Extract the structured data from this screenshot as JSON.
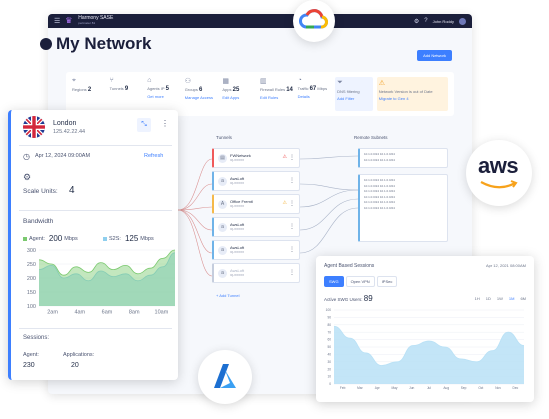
{
  "topbar": {
    "brand": "Harmony SASE",
    "brand_sub": "perimeter 81",
    "user": "John Roddy"
  },
  "page": {
    "title": "My Network",
    "add_button": "Add Network"
  },
  "stats": [
    {
      "icon": "location-icon",
      "label": "Regions",
      "value": "2",
      "sub": "2"
    },
    {
      "icon": "tunnels-icon",
      "label": "Tunnels",
      "value": "9"
    },
    {
      "icon": "agents-icon",
      "label": "Agents IP",
      "value": "5",
      "link": "Get more"
    },
    {
      "icon": "groups-icon",
      "label": "Groups",
      "value": "6",
      "link": "Manage Access"
    },
    {
      "icon": "apps-icon",
      "label": "Apps",
      "value": "25",
      "link": "Edit Apps"
    },
    {
      "icon": "firewall-icon",
      "label": "Firewall Rules",
      "value": "14",
      "link": "Edit Rules"
    },
    {
      "icon": "traffic-icon",
      "label": "Traffic",
      "value": "67",
      "unit": "Mbps",
      "link": "Details"
    },
    {
      "icon": "filter-icon",
      "label": "DNS filtering",
      "link": "Add Filter"
    },
    {
      "icon": "warning-icon",
      "label": "Network Version is out of Date",
      "link": "Migrate to Gen 4"
    }
  ],
  "tunnels_label": "Tunnels",
  "remote_label": "Remote Subnets",
  "tunnels": [
    {
      "name": "FWNetwork",
      "sub": "IQ-XXXXX",
      "status": "error"
    },
    {
      "name": "AwsLoft",
      "sub": "IQ-XXXXX",
      "status": "ok"
    },
    {
      "name": "Office Fremtl",
      "sub": "IQ-XXXXX",
      "status": "warn"
    },
    {
      "name": "AwsLoft",
      "sub": "IQ-XXXXX",
      "status": "ok"
    },
    {
      "name": "AwsLoft",
      "sub": "IQ-XXXXX",
      "status": "ok"
    },
    {
      "name": "AwsLoft",
      "sub": "IQ-XXXXX",
      "status": "disabled"
    }
  ],
  "add_tunnel": "+ Add Tunnel",
  "subnet_rows": [
    "10.1.0.0/24   10.1.0.0/24",
    "10.1.0.0/24   10.1.0.0/24",
    "10.1.0.0/24   10.1.0.0/24"
  ],
  "london": {
    "city": "London",
    "ip": "125.42.22.44",
    "date": "Apr 12, 2024  09:00AM",
    "refresh": "Refresh",
    "scale_label": "Scale Units:",
    "scale_value": "4",
    "bandwidth_label": "Bandwidth",
    "agent_label": "Agent:",
    "agent_value": "200",
    "agent_unit": "Mbps",
    "s2s_label": "S2S:",
    "s2s_value": "125",
    "s2s_unit": "Mbps",
    "sessions_label": "Sessions:",
    "sessions_agent_label": "Agent:",
    "sessions_agent_value": "230",
    "sessions_app_label": "Applications:",
    "sessions_app_value": "20"
  },
  "agent_card": {
    "title": "Agent Based Sessions",
    "date": "Apr 12, 2021  08:00AM",
    "tabs": [
      "SWG",
      "Open VPN",
      "IPSec"
    ],
    "users_label": "Active SWG Users:",
    "users_value": "89",
    "ranges": [
      "1H",
      "1D",
      "1W",
      "1M",
      "6M"
    ]
  },
  "colors": {
    "accent": "#3d7fff",
    "navy": "#1b1f3b",
    "agent_series": "#7bc96f",
    "s2s_series": "#8fcfee",
    "area2": "#b9e1f6"
  },
  "chart_data": [
    {
      "type": "area",
      "title": "Bandwidth",
      "x": [
        "2am",
        "4am",
        "6am",
        "8am",
        "10am"
      ],
      "ylim": [
        100,
        300
      ],
      "yticks": [
        100,
        150,
        200,
        250,
        300
      ],
      "series": [
        {
          "name": "Agent",
          "values": [
            230,
            245,
            200,
            215,
            190,
            225,
            205,
            215,
            190,
            210,
            240,
            290
          ]
        },
        {
          "name": "S2S",
          "values": [
            265,
            250,
            210,
            240,
            220,
            255,
            230,
            245,
            215,
            235,
            270,
            300
          ]
        }
      ]
    },
    {
      "type": "area",
      "title": "Agent Based Sessions",
      "x": [
        "Feb",
        "Mar",
        "Apr",
        "May",
        "Jun",
        "Jul",
        "Aug",
        "Sep",
        "Oct",
        "Nov",
        "Dec"
      ],
      "ylim": [
        0,
        100
      ],
      "yticks": [
        0,
        10,
        20,
        30,
        40,
        50,
        60,
        70,
        80,
        90,
        100
      ],
      "series": [
        {
          "name": "Active SWG Users",
          "values": [
            78,
            62,
            42,
            25,
            30,
            52,
            58,
            50,
            34,
            30,
            45,
            70,
            52
          ]
        }
      ]
    }
  ]
}
